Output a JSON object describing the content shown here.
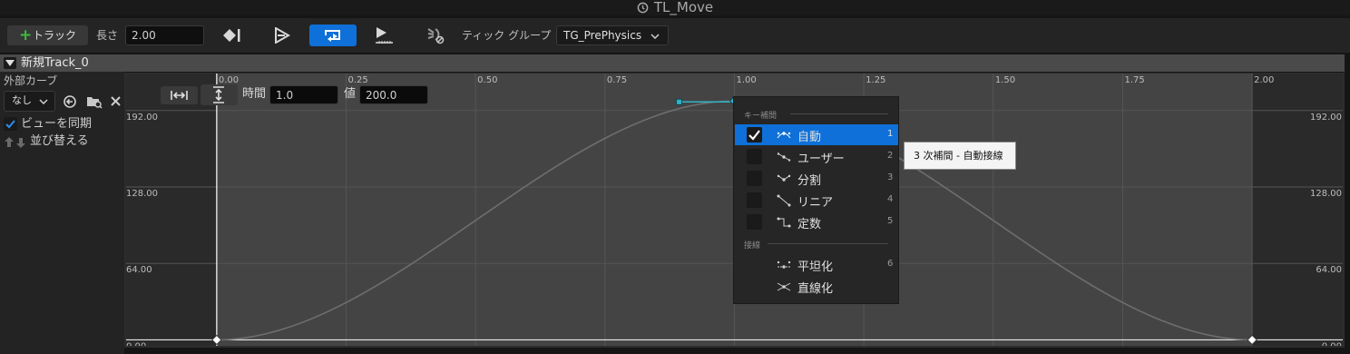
{
  "window": {
    "title": "TL_Move"
  },
  "toolbar": {
    "add_track_label": "トラック",
    "length_label": "長さ",
    "length_value": "2.00",
    "tick_group_label": "ティック グループ",
    "tick_group_value": "TG_PrePhysics"
  },
  "track": {
    "name": "新規Track_0"
  },
  "left_panel": {
    "external_curve_label": "外部カーブ",
    "external_curve_value": "なし",
    "sync_view_label": "ビューを同期",
    "sync_view_checked": true,
    "reorder_label": "並び替える"
  },
  "key_editor": {
    "time_label": "時間",
    "time_value": "1.0",
    "value_label": "値",
    "value_value": "200.0"
  },
  "chart_data": {
    "type": "line",
    "x_ticks": [
      "0.00",
      "0.25",
      "0.50",
      "0.75",
      "1.00",
      "1.25",
      "1.50",
      "1.75",
      "2.00"
    ],
    "y_ticks": [
      "0.00",
      "64.00",
      "128.00",
      "192.00"
    ],
    "xlim": [
      -0.175,
      2.175
    ],
    "ylim": [
      -5,
      223
    ],
    "keys": [
      {
        "x": 0.0,
        "y": 0
      },
      {
        "x": 1.0,
        "y": 200
      },
      {
        "x": 2.0,
        "y": 0
      }
    ],
    "selected_key": 1,
    "active_range": [
      0.0,
      2.0
    ]
  },
  "context_menu": {
    "section_key_interp": "キー補間",
    "section_tangents": "接線",
    "interp_items": [
      {
        "label": "自動",
        "shortcut": "1",
        "checked": true,
        "icon": "auto-interp-icon"
      },
      {
        "label": "ユーザー",
        "shortcut": "2",
        "checked": false,
        "icon": "user-interp-icon"
      },
      {
        "label": "分割",
        "shortcut": "3",
        "checked": false,
        "icon": "break-interp-icon"
      },
      {
        "label": "リニア",
        "shortcut": "4",
        "checked": false,
        "icon": "linear-interp-icon"
      },
      {
        "label": "定数",
        "shortcut": "5",
        "checked": false,
        "icon": "constant-interp-icon"
      }
    ],
    "tangent_items": [
      {
        "label": "平坦化",
        "shortcut": "6",
        "icon": "flatten-icon"
      },
      {
        "label": "直線化",
        "shortcut": "",
        "icon": "straighten-icon"
      }
    ]
  },
  "tooltip": {
    "text": "3 次補間 - 自動接線"
  },
  "colors": {
    "accent": "#0e70d8",
    "curve": "#6e6e6e",
    "tangent": "#2fb3c7",
    "panel": "#232323",
    "graph_inactive": "#2a2a2a",
    "graph_active": "#444444"
  }
}
